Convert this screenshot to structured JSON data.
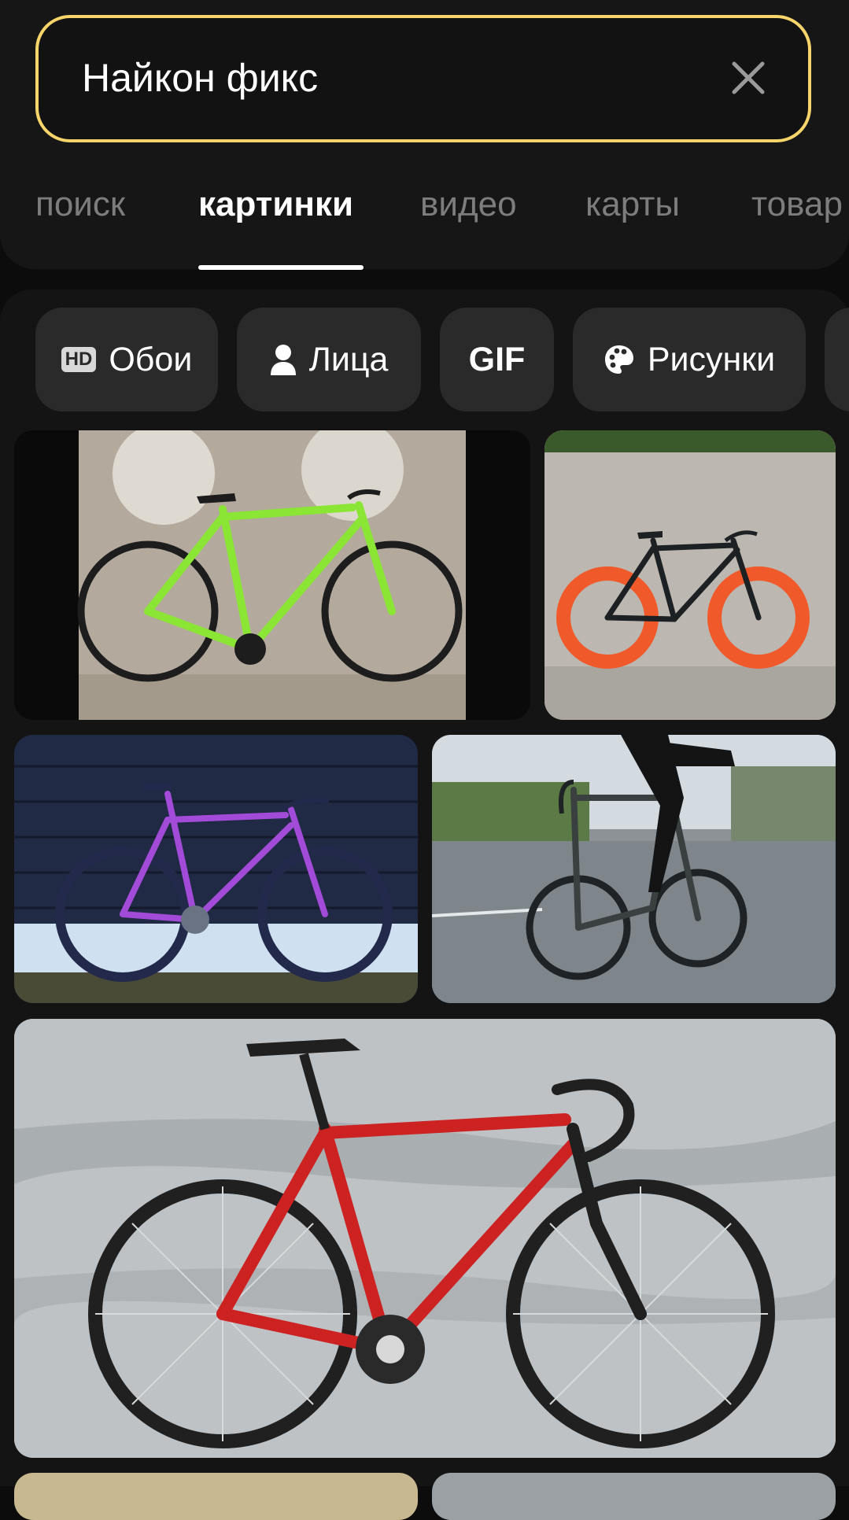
{
  "search": {
    "query": "Найкон фикс"
  },
  "tabs": [
    {
      "label": "поиск"
    },
    {
      "label": "картинки"
    },
    {
      "label": "видео"
    },
    {
      "label": "карты"
    },
    {
      "label": "товар"
    }
  ],
  "active_tab": "картинки",
  "filters": [
    {
      "label": "Обои",
      "badge": "HD"
    },
    {
      "label": "Лица",
      "icon": "person-icon"
    },
    {
      "label": "GIF"
    },
    {
      "label": "Рисунки",
      "icon": "palette-icon"
    }
  ],
  "colors": {
    "accent": "#f7d56a",
    "background": "#0c0c0c",
    "chip": "#2a2a2a"
  }
}
